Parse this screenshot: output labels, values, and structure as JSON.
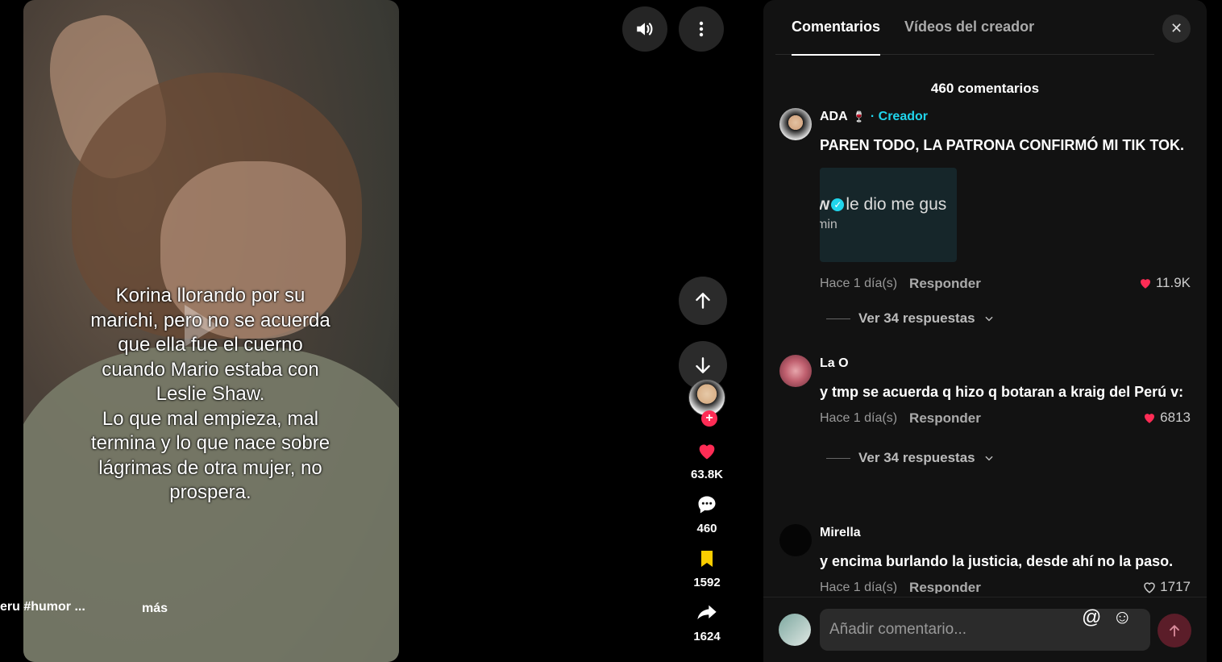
{
  "video": {
    "caption": "Korina llorando por su\nmarichi, pero no se acuerda\nque ella fue el cuerno\ncuando Mario estaba con\nLeslie Shaw.\nLo que mal empieza, mal\ntermina y lo que nace sobre\nlágrimas de otra mujer, no\nprospera.",
    "description": "eru #humor ...",
    "more_label": "más"
  },
  "actions": {
    "likes": "63.8K",
    "comments": "460",
    "saves": "1592",
    "shares": "1624",
    "follow_plus": "+"
  },
  "panel": {
    "tabs": [
      "Comentarios",
      "Vídeos del creador"
    ],
    "comment_count": "460 comentarios",
    "close": "✕",
    "comments": [
      {
        "name": "ADA",
        "badge": "· Creador",
        "text": "PAREN TODO, LA PATRONA CONFIRMÓ MI TIK TOK.",
        "attachment_line1": "w",
        "attachment_line2": "le dio me gus",
        "attachment_line3": "min",
        "time": "Hace 1 día(s)",
        "reply": "Responder",
        "likes": "11.9K",
        "more": "Ver 34 respuestas"
      },
      {
        "name": "La O",
        "text": "y tmp se acuerda q hizo q botaran a kraig del Perú v:",
        "time": "Hace 1 día(s)",
        "reply": "Responder",
        "likes": "6813",
        "more": "Ver 34 respuestas"
      },
      {
        "name": "Mirella",
        "text": "y encima burlando la justicia, desde ahí no la paso.",
        "time": "Hace 1 día(s)",
        "reply": "Responder",
        "likes": "1717"
      }
    ],
    "input_placeholder": "Añadir comentario..."
  },
  "colors": {
    "accent": "#fe2c55",
    "creator": "#20d5ec",
    "saved": "#facd00"
  }
}
